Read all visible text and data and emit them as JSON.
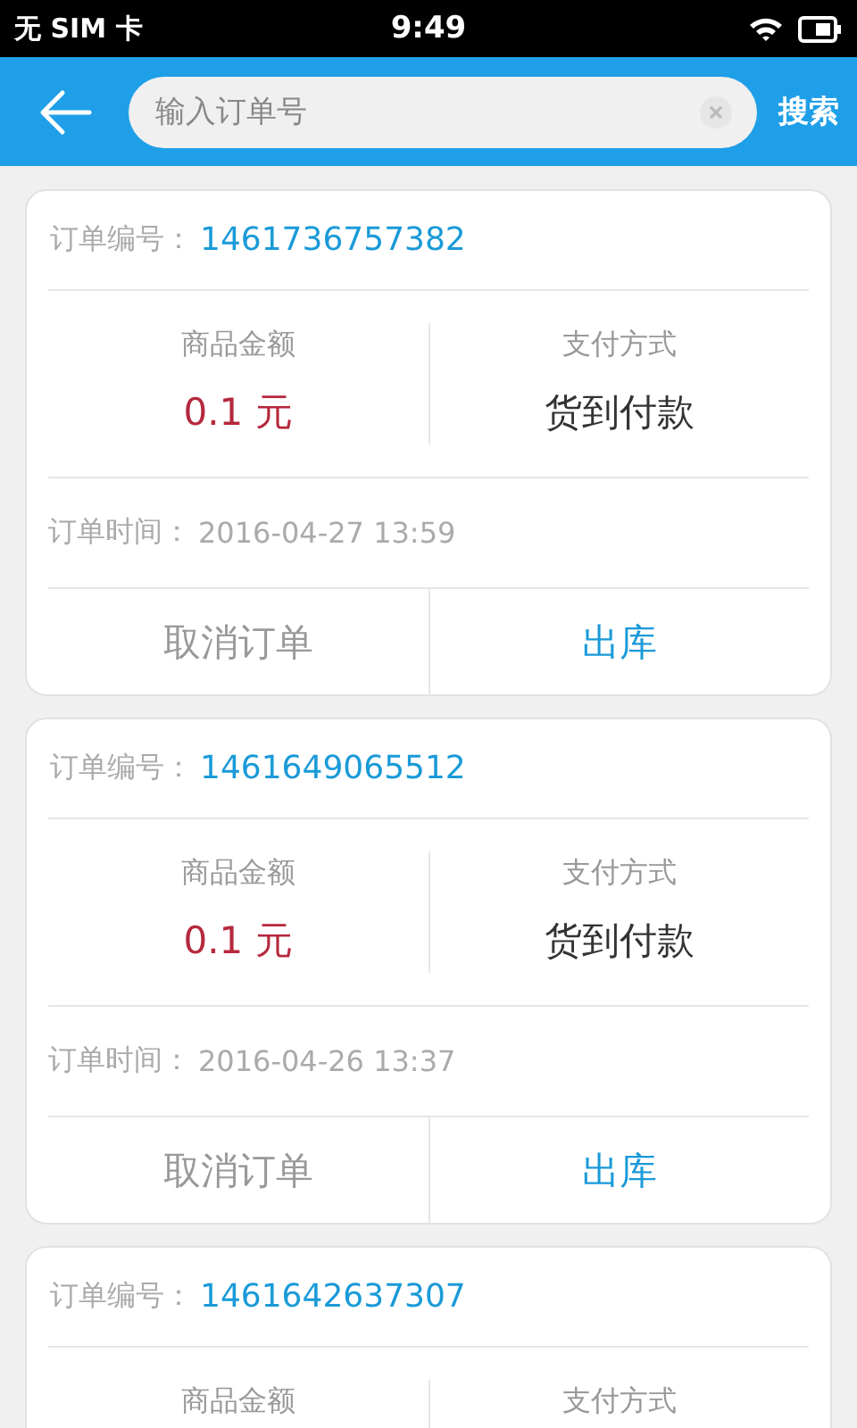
{
  "status_bar": {
    "carrier": "无 SIM 卡",
    "time": "9:49"
  },
  "header": {
    "search": {
      "placeholder": "输入订单号"
    },
    "search_button": "搜索"
  },
  "orders": [
    {
      "order_label": "订单编号：",
      "order_no": "1461736757382",
      "amount_label": "商品金额",
      "amount": "0.1 元",
      "payment_label": "支付方式",
      "payment": "货到付款",
      "time_label": "订单时间：",
      "time": "2016-04-27 13:59",
      "actions": [
        {
          "label": "取消订单",
          "kind": "secondary"
        },
        {
          "label": "出库",
          "kind": "primary"
        }
      ]
    },
    {
      "order_label": "订单编号：",
      "order_no": "1461649065512",
      "amount_label": "商品金额",
      "amount": "0.1 元",
      "payment_label": "支付方式",
      "payment": "货到付款",
      "time_label": "订单时间：",
      "time": "2016-04-26 13:37",
      "actions": [
        {
          "label": "取消订单",
          "kind": "secondary"
        },
        {
          "label": "出库",
          "kind": "primary"
        }
      ]
    },
    {
      "order_label": "订单编号：",
      "order_no": "1461642637307",
      "amount_label": "商品金额",
      "payment_label": "支付方式"
    }
  ]
}
